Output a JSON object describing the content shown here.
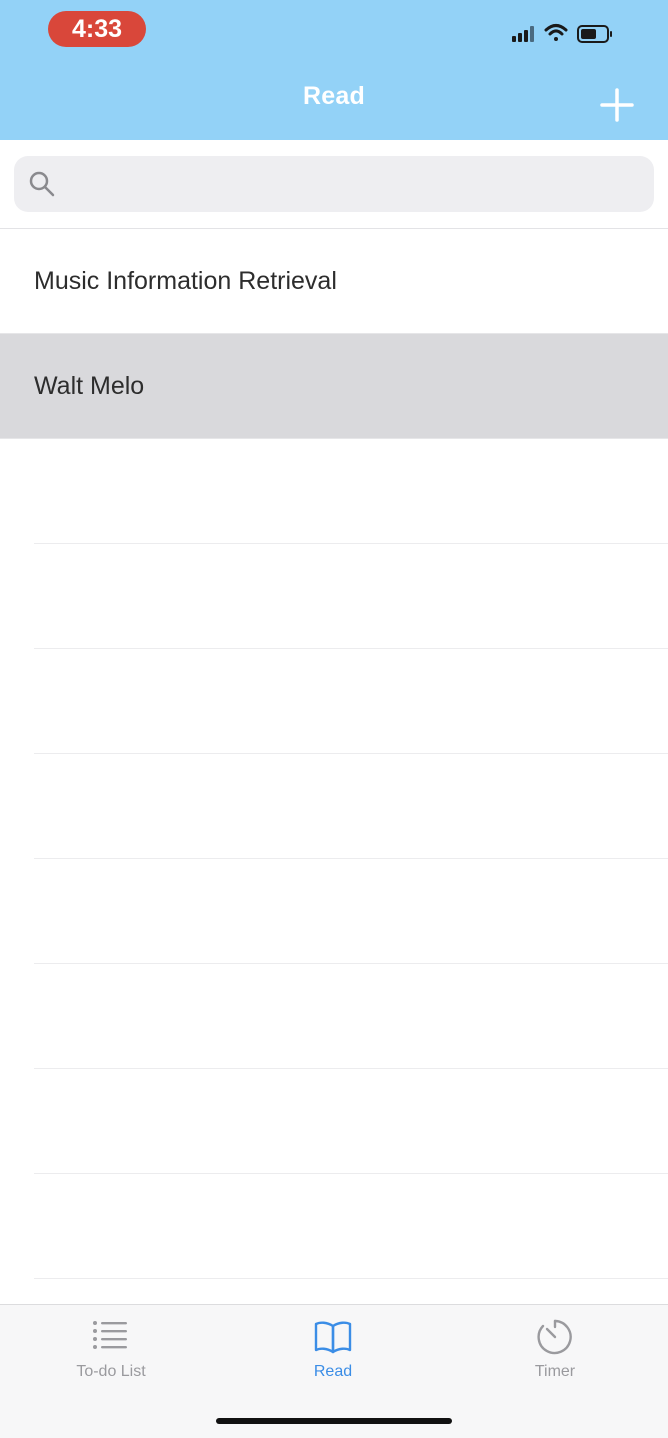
{
  "status_bar": {
    "time": "4:33"
  },
  "nav": {
    "title": "Read",
    "add_icon": "plus-icon"
  },
  "search": {
    "placeholder": "",
    "value": "",
    "icon": "search-icon"
  },
  "list": {
    "items": [
      {
        "label": "Music Information Retrieval",
        "selected": false
      },
      {
        "label": "Walt Melo",
        "selected": true
      }
    ]
  },
  "tab_bar": {
    "tabs": [
      {
        "label": "To-do List",
        "icon": "list-icon",
        "active": false
      },
      {
        "label": "Read",
        "icon": "book-icon",
        "active": true
      },
      {
        "label": "Timer",
        "icon": "timer-icon",
        "active": false
      }
    ]
  },
  "colors": {
    "header_bg": "#93d2f7",
    "time_pill": "#d9473a",
    "selected_row": "#d9d9dc",
    "active_tab": "#3b8de6",
    "inactive_tab": "#9a9a9e"
  }
}
